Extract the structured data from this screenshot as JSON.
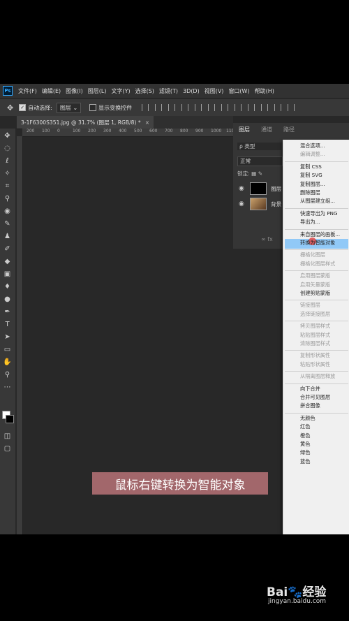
{
  "menubar": {
    "logo": "Ps",
    "items": [
      "文件(F)",
      "编辑(E)",
      "图像(I)",
      "图层(L)",
      "文字(Y)",
      "选择(S)",
      "滤镜(T)",
      "3D(D)",
      "视图(V)",
      "窗口(W)",
      "帮助(H)"
    ]
  },
  "options": {
    "auto_select_label": "自动选择:",
    "auto_select_target": "图层",
    "show_transform_label": "显示变换控件"
  },
  "document": {
    "tab_title": "3-1F6300S351.jpg @ 31.7% (图层 1, RGB/8) *",
    "close": "×"
  },
  "ruler": {
    "ticks": [
      "200",
      "100",
      "0",
      "100",
      "200",
      "300",
      "400",
      "500",
      "600",
      "700",
      "800",
      "900",
      "1000",
      "1100",
      "12"
    ]
  },
  "layers_panel": {
    "tabs": [
      "图层",
      "通道",
      "路径"
    ],
    "filter_kind": "ρ 类型",
    "blend_mode": "正常",
    "lock_label": "锁定:",
    "layers": [
      {
        "name": "图层",
        "visible": true,
        "thumb_color": "#000000"
      },
      {
        "name": "背景",
        "visible": true,
        "thumb_color": "#8a5a2e"
      }
    ],
    "footer_icons": "∞ fx"
  },
  "context_menu": {
    "items": [
      {
        "label": "混合选项...",
        "enabled": true
      },
      {
        "label": "编辑调整...",
        "enabled": false
      },
      {
        "sep": true
      },
      {
        "label": "复制 CSS",
        "enabled": true
      },
      {
        "label": "复制 SVG",
        "enabled": true
      },
      {
        "label": "复制图层...",
        "enabled": true
      },
      {
        "label": "删除图层",
        "enabled": true
      },
      {
        "label": "从图层建立组...",
        "enabled": true
      },
      {
        "sep": true
      },
      {
        "label": "快速导出为 PNG",
        "enabled": true
      },
      {
        "label": "导出为...",
        "enabled": true
      },
      {
        "sep": true
      },
      {
        "label": "来自图层的画板...",
        "enabled": true
      },
      {
        "label": "转换为智能对象",
        "enabled": true,
        "highlighted": true
      },
      {
        "sep": true
      },
      {
        "label": "栅格化图层",
        "enabled": false
      },
      {
        "label": "栅格化图层样式",
        "enabled": false
      },
      {
        "sep": true
      },
      {
        "label": "启用图层蒙版",
        "enabled": false
      },
      {
        "label": "启用矢量蒙版",
        "enabled": false
      },
      {
        "label": "创建剪贴蒙版",
        "enabled": true
      },
      {
        "sep": true
      },
      {
        "label": "链接图层",
        "enabled": false
      },
      {
        "label": "选择链接图层",
        "enabled": false
      },
      {
        "sep": true
      },
      {
        "label": "拷贝图层样式",
        "enabled": false
      },
      {
        "label": "粘贴图层样式",
        "enabled": false
      },
      {
        "label": "清除图层样式",
        "enabled": false
      },
      {
        "sep": true
      },
      {
        "label": "复制形状属性",
        "enabled": false
      },
      {
        "label": "粘贴形状属性",
        "enabled": false
      },
      {
        "sep": true
      },
      {
        "label": "从隔离图层释放",
        "enabled": false
      },
      {
        "sep": true
      },
      {
        "label": "向下合并",
        "enabled": true
      },
      {
        "label": "合并可见图层",
        "enabled": true
      },
      {
        "label": "拼合图像",
        "enabled": true
      },
      {
        "sep": true
      },
      {
        "label": "无颜色",
        "enabled": true
      },
      {
        "label": "红色",
        "enabled": true
      },
      {
        "label": "橙色",
        "enabled": true
      },
      {
        "label": "黄色",
        "enabled": true
      },
      {
        "label": "绿色",
        "enabled": true
      },
      {
        "label": "蓝色",
        "enabled": true
      }
    ]
  },
  "caption": "鼠标右键转换为智能对象",
  "watermark": {
    "logo": "Bai🐾经验",
    "url": "jingyan.baidu.com"
  },
  "colors": {
    "app_bg": "#282828",
    "menu_highlight": "#91c9f7",
    "caption_bg": "#a2676b",
    "ps_blue": "#31a8ff"
  }
}
